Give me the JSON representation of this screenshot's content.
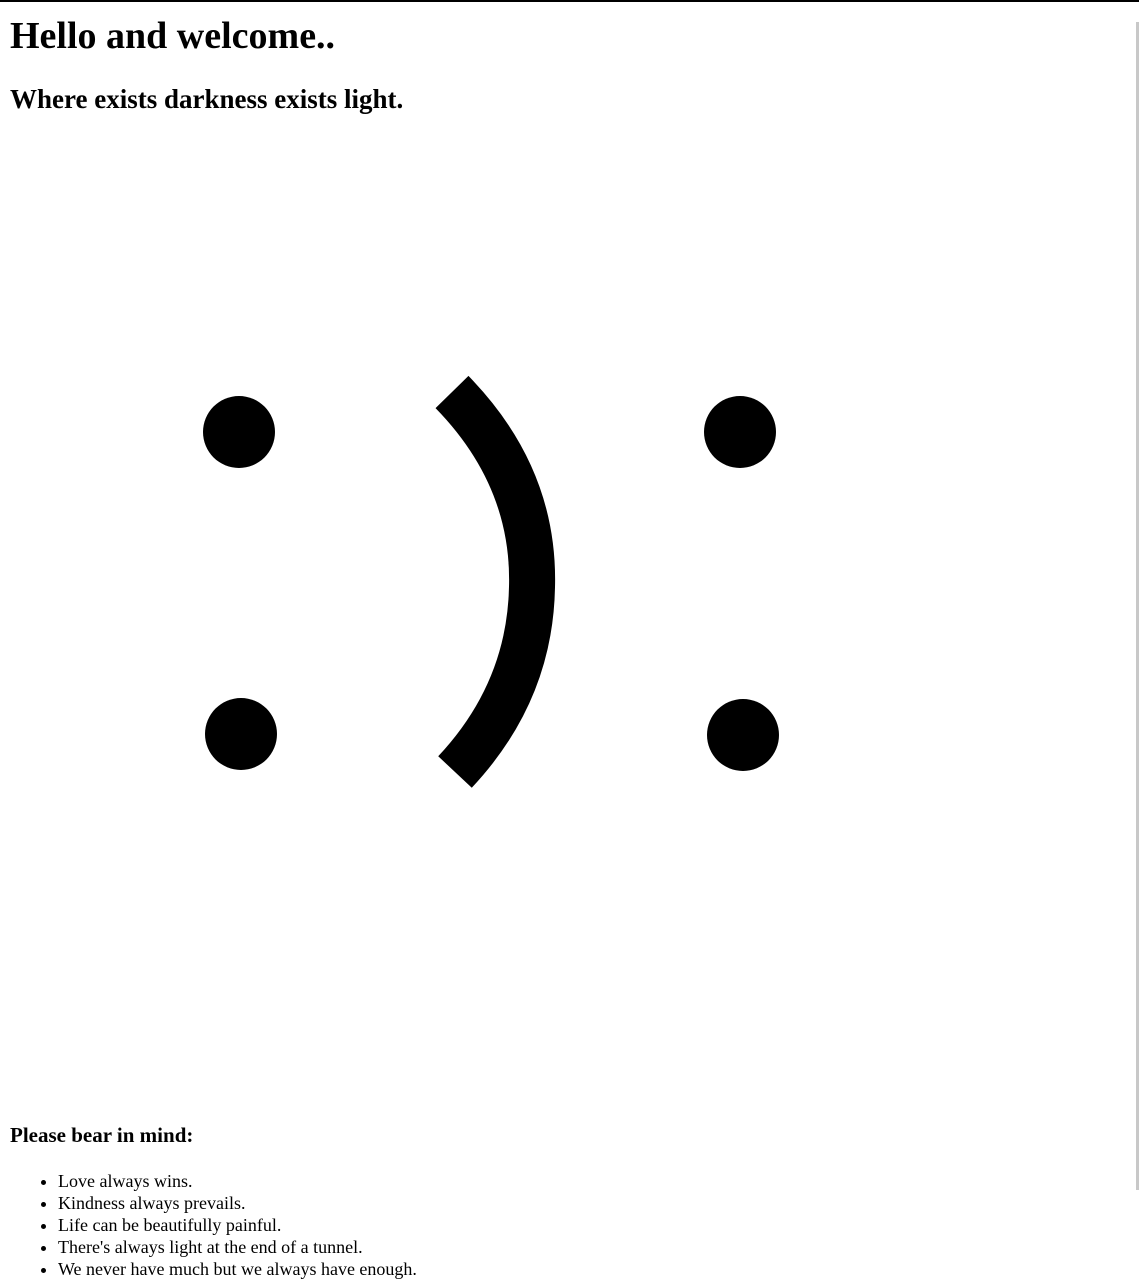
{
  "page": {
    "title": "Hello and welcome..",
    "subtitle": "Where exists darkness exists light."
  },
  "artwork": {
    "glyph": ":):",
    "color": "#000000"
  },
  "reminder": {
    "heading": "Please bear in mind:",
    "items": [
      "Love always wins.",
      "Kindness always prevails.",
      "Life can be beautifully painful.",
      "There's always light at the end of a tunnel.",
      "We never have much but we always have enough."
    ]
  }
}
